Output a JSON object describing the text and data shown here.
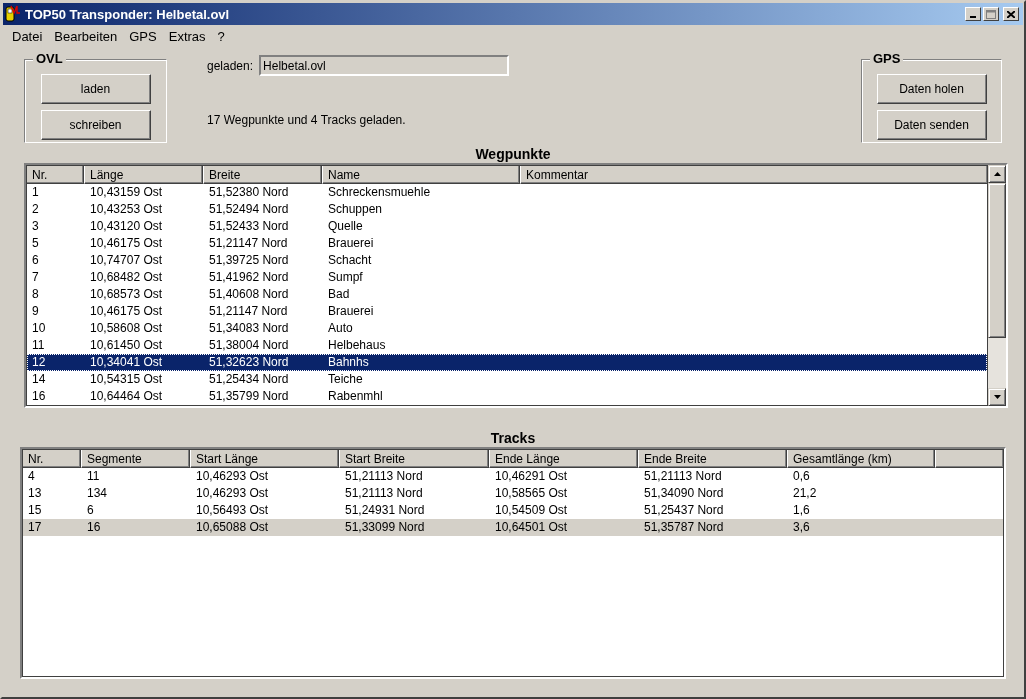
{
  "window": {
    "title": "TOP50 Transponder: Helbetal.ovl"
  },
  "menu": [
    {
      "label": "Datei"
    },
    {
      "label": "Bearbeiten"
    },
    {
      "label": "GPS"
    },
    {
      "label": "Extras"
    },
    {
      "label": "?"
    }
  ],
  "ovl_group": {
    "title": "OVL",
    "buttons": [
      "laden",
      "schreiben"
    ]
  },
  "loaded": {
    "label": "geladen:",
    "value": "Helbetal.ovl",
    "status": "17 Wegpunkte und 4 Tracks geladen."
  },
  "gps_group": {
    "title": "GPS",
    "buttons": [
      "Daten holen",
      "Daten senden"
    ]
  },
  "waypoints": {
    "title": "Wegpunkte",
    "focused": true,
    "columns": [
      "Nr.",
      "Länge",
      "Breite",
      "Name",
      "Kommentar"
    ],
    "rows": [
      {
        "cells": [
          "1",
          "10,43159 Ost",
          "51,52380 Nord",
          "Schreckensmuehle"
        ],
        "selected": false
      },
      {
        "cells": [
          "2",
          "10,43253 Ost",
          "51,52494 Nord",
          "Schuppen"
        ],
        "selected": false
      },
      {
        "cells": [
          "3",
          "10,43120 Ost",
          "51,52433 Nord",
          "Quelle"
        ],
        "selected": false
      },
      {
        "cells": [
          "5",
          "10,46175 Ost",
          "51,21147 Nord",
          "Brauerei"
        ],
        "selected": false
      },
      {
        "cells": [
          "6",
          "10,74707 Ost",
          "51,39725 Nord",
          "Schacht"
        ],
        "selected": false
      },
      {
        "cells": [
          "7",
          "10,68482 Ost",
          "51,41962 Nord",
          "Sumpf"
        ],
        "selected": false
      },
      {
        "cells": [
          "8",
          "10,68573 Ost",
          "51,40608 Nord",
          "Bad"
        ],
        "selected": false
      },
      {
        "cells": [
          "9",
          "10,46175 Ost",
          "51,21147 Nord",
          "Brauerei"
        ],
        "selected": false
      },
      {
        "cells": [
          "10",
          "10,58608 Ost",
          "51,34083 Nord",
          "Auto"
        ],
        "selected": false
      },
      {
        "cells": [
          "11",
          "10,61450 Ost",
          "51,38004 Nord",
          "Helbehaus"
        ],
        "selected": false
      },
      {
        "cells": [
          "12",
          "10,34041 Ost",
          "51,32623 Nord",
          "Bahnhs"
        ],
        "selected": true
      },
      {
        "cells": [
          "14",
          "10,54315 Ost",
          "51,25434 Nord",
          "Teiche"
        ],
        "selected": false
      },
      {
        "cells": [
          "16",
          "10,64464 Ost",
          "51,35799 Nord",
          "Rabenmhl"
        ],
        "selected": false
      }
    ]
  },
  "tracks": {
    "title": "Tracks",
    "focused": false,
    "columns": [
      "Nr.",
      "Segmente",
      "Start Länge",
      "Start Breite",
      "Ende Länge",
      "Ende Breite",
      "Gesamtlänge (km)"
    ],
    "rows": [
      {
        "cells": [
          "4",
          "11",
          "10,46293 Ost",
          "51,21113 Nord",
          "10,46291 Ost",
          "51,21113 Nord",
          "0,6"
        ],
        "selected": false
      },
      {
        "cells": [
          "13",
          "134",
          "10,46293 Ost",
          "51,21113 Nord",
          "10,58565 Ost",
          "51,34090 Nord",
          "21,2"
        ],
        "selected": false
      },
      {
        "cells": [
          "15",
          "6",
          "10,56493 Ost",
          "51,24931 Nord",
          "10,54509 Ost",
          "51,25437 Nord",
          "1,6"
        ],
        "selected": false
      },
      {
        "cells": [
          "17",
          "16",
          "10,65088 Ost",
          "51,33099 Nord",
          "10,64501 Ost",
          "51,35787 Nord",
          "3,6"
        ],
        "selected": true
      }
    ]
  }
}
